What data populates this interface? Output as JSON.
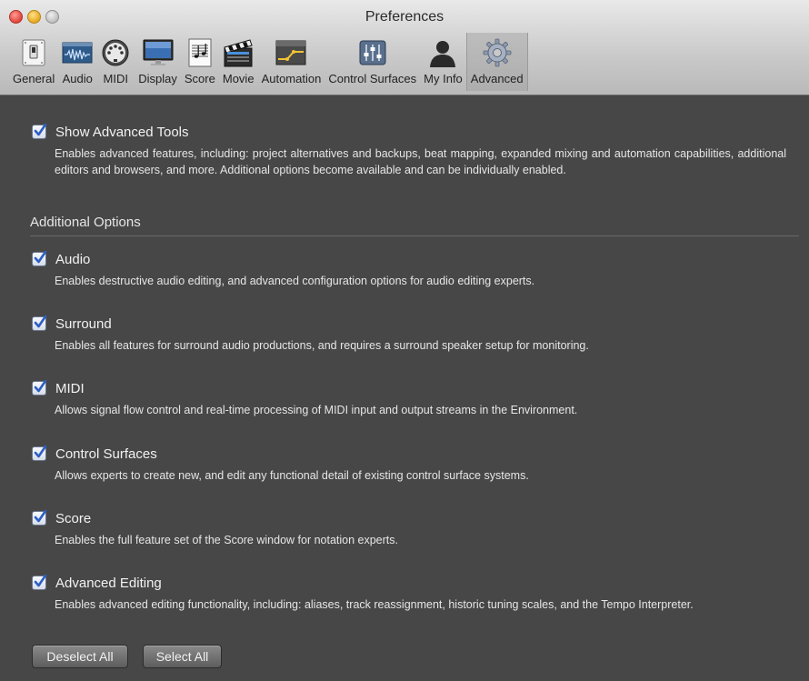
{
  "window": {
    "title": "Preferences"
  },
  "toolbar": {
    "items": [
      {
        "label": "General",
        "icon": "switch-icon"
      },
      {
        "label": "Audio",
        "icon": "waveform-icon"
      },
      {
        "label": "MIDI",
        "icon": "midi-connector-icon"
      },
      {
        "label": "Display",
        "icon": "monitor-icon"
      },
      {
        "label": "Score",
        "icon": "sheet-music-icon"
      },
      {
        "label": "Movie",
        "icon": "clapperboard-icon"
      },
      {
        "label": "Automation",
        "icon": "automation-curve-icon"
      },
      {
        "label": "Control Surfaces",
        "icon": "faders-icon"
      },
      {
        "label": "My Info",
        "icon": "person-silhouette-icon"
      },
      {
        "label": "Advanced",
        "icon": "gear-icon",
        "selected": true
      }
    ]
  },
  "advanced": {
    "show_tools": {
      "label": "Show Advanced Tools",
      "checked": true,
      "description": "Enables advanced features, including: project alternatives and backups, beat mapping, expanded mixing and automation capabilities, additional editors and browsers, and more. Additional options become available and can be individually enabled."
    },
    "section_title": "Additional Options",
    "options": [
      {
        "label": "Audio",
        "checked": true,
        "description": "Enables destructive audio editing, and advanced configuration options for audio editing experts."
      },
      {
        "label": "Surround",
        "checked": true,
        "description": "Enables all features for surround audio productions, and requires a surround speaker setup for monitoring."
      },
      {
        "label": "MIDI",
        "checked": true,
        "description": "Allows signal flow control and real-time processing of MIDI input and output streams in the Environment."
      },
      {
        "label": "Control Surfaces",
        "checked": true,
        "description": "Allows experts to create new, and edit any functional detail of existing control surface systems."
      },
      {
        "label": "Score",
        "checked": true,
        "description": "Enables the full feature set of the Score window for notation experts."
      },
      {
        "label": "Advanced Editing",
        "checked": true,
        "description": "Enables advanced editing functionality, including: aliases, track reassignment, historic tuning scales, and the Tempo Interpreter."
      }
    ],
    "buttons": {
      "deselect_all": "Deselect All",
      "select_all": "Select All"
    }
  },
  "colors": {
    "background": "#474747",
    "checkmark": "#2d5fc4"
  }
}
